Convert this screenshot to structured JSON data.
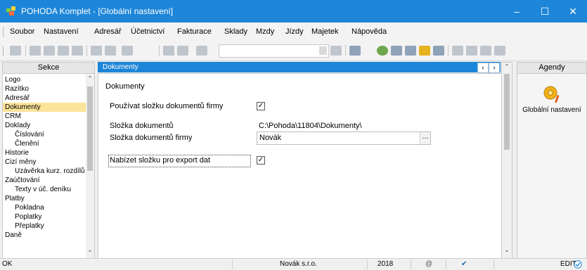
{
  "window": {
    "title": "POHODA Komplet - [Globální nastavení]"
  },
  "menu": [
    "Soubor",
    "Nastavení",
    "Adresář",
    "Účetnictví",
    "Fakturace",
    "Sklady",
    "Mzdy",
    "Jízdy",
    "Majetek",
    "Nápověda"
  ],
  "sidebar": {
    "header": "Sekce",
    "items": [
      {
        "label": "Logo",
        "level": 0
      },
      {
        "label": "Razítko",
        "level": 0
      },
      {
        "label": "Adresář",
        "level": 0
      },
      {
        "label": "Dokumenty",
        "level": 0,
        "selected": true
      },
      {
        "label": "CRM",
        "level": 0
      },
      {
        "label": "Doklady",
        "level": 0
      },
      {
        "label": "Číslování",
        "level": 1
      },
      {
        "label": "Členění",
        "level": 1
      },
      {
        "label": "Historie",
        "level": 0
      },
      {
        "label": "Cizí měny",
        "level": 0
      },
      {
        "label": "Uzávěrka kurz. rozdílů",
        "level": 1
      },
      {
        "label": "Zaúčtování",
        "level": 0
      },
      {
        "label": "Texty v úč. deníku",
        "level": 1
      },
      {
        "label": "Platby",
        "level": 0
      },
      {
        "label": "Pokladna",
        "level": 1
      },
      {
        "label": "Poplatky",
        "level": 1
      },
      {
        "label": "Přeplatky",
        "level": 1
      },
      {
        "label": "Daně",
        "level": 0
      }
    ]
  },
  "main": {
    "header": "Dokumenty",
    "section_title": "Dokumenty",
    "use_folder_label": "Používat složku dokumentů firmy",
    "use_folder_checked": true,
    "docs_folder_label": "Složka dokumentů",
    "docs_folder_value": "C:\\Pohoda\\11804\\Dokumenty\\",
    "company_folder_label": "Složka dokumentů firmy",
    "company_folder_value": "Novák",
    "export_label": "Nabízet složku pro export dat",
    "export_checked": true
  },
  "agendy": {
    "header": "Agendy",
    "item": "Globální nastavení"
  },
  "status": {
    "left": "OK",
    "company": "Novák s.r.o.",
    "year": "2018",
    "mode": "EDIT"
  },
  "colors": {
    "titlebar": "#1e86d8",
    "selection": "#fce39a"
  }
}
